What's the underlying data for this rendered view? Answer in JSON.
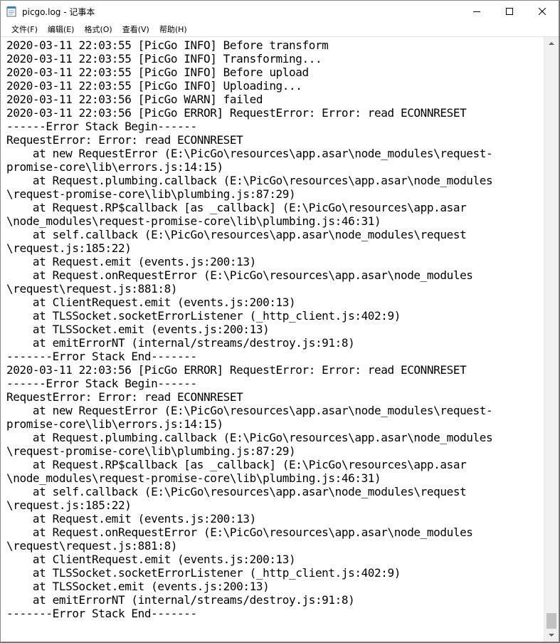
{
  "window": {
    "title": "picgo.log - 记事本",
    "icon": "notepad-icon"
  },
  "caption": {
    "minimize_icon": "minimize-icon",
    "maximize_icon": "maximize-icon",
    "close_icon": "close-icon"
  },
  "menu": [
    {
      "label": "文件(F)"
    },
    {
      "label": "编辑(E)"
    },
    {
      "label": "格式(O)"
    },
    {
      "label": "查看(V)"
    },
    {
      "label": "帮助(H)"
    }
  ],
  "editor": {
    "lines": [
      "2020-03-11 22:03:55 [PicGo INFO] Before transform",
      "2020-03-11 22:03:55 [PicGo INFO] Transforming...",
      "2020-03-11 22:03:55 [PicGo INFO] Before upload",
      "2020-03-11 22:03:55 [PicGo INFO] Uploading...",
      "2020-03-11 22:03:56 [PicGo WARN] failed",
      "2020-03-11 22:03:56 [PicGo ERROR] RequestError: Error: read ECONNRESET",
      "------Error Stack Begin------",
      "RequestError: Error: read ECONNRESET",
      "    at new RequestError (E:\\PicGo\\resources\\app.asar\\node_modules\\request-",
      "promise-core\\lib\\errors.js:14:15)",
      "    at Request.plumbing.callback (E:\\PicGo\\resources\\app.asar\\node_modules",
      "\\request-promise-core\\lib\\plumbing.js:87:29)",
      "    at Request.RP$callback [as _callback] (E:\\PicGo\\resources\\app.asar",
      "\\node_modules\\request-promise-core\\lib\\plumbing.js:46:31)",
      "    at self.callback (E:\\PicGo\\resources\\app.asar\\node_modules\\request",
      "\\request.js:185:22)",
      "    at Request.emit (events.js:200:13)",
      "    at Request.onRequestError (E:\\PicGo\\resources\\app.asar\\node_modules",
      "\\request\\request.js:881:8)",
      "    at ClientRequest.emit (events.js:200:13)",
      "    at TLSSocket.socketErrorListener (_http_client.js:402:9)",
      "    at TLSSocket.emit (events.js:200:13)",
      "    at emitErrorNT (internal/streams/destroy.js:91:8)",
      "-------Error Stack End-------",
      "2020-03-11 22:03:56 [PicGo ERROR] RequestError: Error: read ECONNRESET",
      "------Error Stack Begin------",
      "RequestError: Error: read ECONNRESET",
      "    at new RequestError (E:\\PicGo\\resources\\app.asar\\node_modules\\request-",
      "promise-core\\lib\\errors.js:14:15)",
      "    at Request.plumbing.callback (E:\\PicGo\\resources\\app.asar\\node_modules",
      "\\request-promise-core\\lib\\plumbing.js:87:29)",
      "    at Request.RP$callback [as _callback] (E:\\PicGo\\resources\\app.asar",
      "\\node_modules\\request-promise-core\\lib\\plumbing.js:46:31)",
      "    at self.callback (E:\\PicGo\\resources\\app.asar\\node_modules\\request",
      "\\request.js:185:22)",
      "    at Request.emit (events.js:200:13)",
      "    at Request.onRequestError (E:\\PicGo\\resources\\app.asar\\node_modules",
      "\\request\\request.js:881:8)",
      "    at ClientRequest.emit (events.js:200:13)",
      "    at TLSSocket.socketErrorListener (_http_client.js:402:9)",
      "    at TLSSocket.emit (events.js:200:13)",
      "    at emitErrorNT (internal/streams/destroy.js:91:8)",
      "-------Error Stack End-------"
    ]
  },
  "scrollbar": {
    "up_icon": "scroll-up-arrow-icon",
    "down_icon": "scroll-down-arrow-icon"
  }
}
